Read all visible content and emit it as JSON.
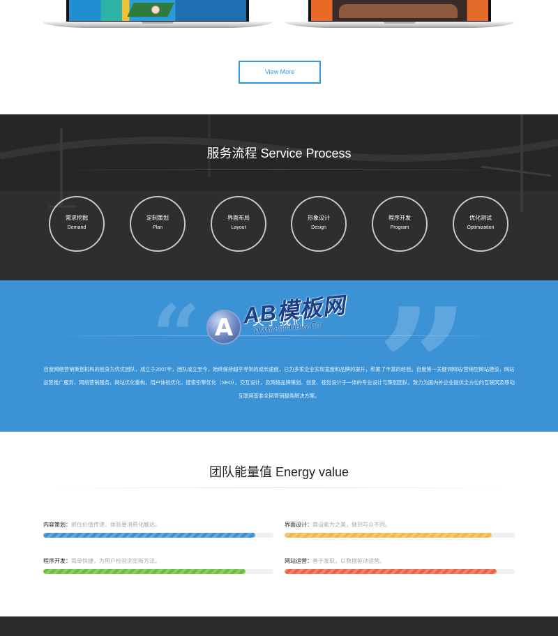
{
  "view_more": {
    "label": "View More"
  },
  "service": {
    "title": "服务流程 Service Process",
    "steps": [
      {
        "zh": "需求挖掘",
        "en": "Demand"
      },
      {
        "zh": "定制策划",
        "en": "Plan"
      },
      {
        "zh": "界面布局",
        "en": "Layout"
      },
      {
        "zh": "形象设计",
        "en": "Design"
      },
      {
        "zh": "程序开发",
        "en": "Program"
      },
      {
        "zh": "优化测试",
        "en": "Optimization"
      }
    ]
  },
  "about": {
    "title": "关于我们",
    "watermark": {
      "badge": "A",
      "brand": "AB模板网",
      "url": "Www.AdminBuy.Cn"
    },
    "description": "自度网络营销策划机构的前身为优优团队，成立于2007年，团队成立至今，始终保持超乎寻常的成长速度，已为多家企业实现宽度和品牌的提升，积累了丰富的经验。自度第一关键词网站/营销型网站建设，网站运营推广服务，网络营销服务，网站优化重构，用户体验优化，搜索引擎优化（SEO），交互设计，及网络品牌策划、创意、视觉设计于一体的专业设计与策划团队，致力为国内外企业提供全方位的互联网及移动互联网基准全网营销服务解决方案。"
  },
  "energy": {
    "title": "团队能量值 Energy value",
    "skills": [
      {
        "name": "内容策划：",
        "note": "抓住价值传递，体验要消费化触达。",
        "percent": 92,
        "color": "#3b8fd3"
      },
      {
        "name": "界面设计：",
        "note": "简设能为之美，做到与众不同。",
        "percent": 90,
        "color": "#f0b84a"
      },
      {
        "name": "程序开发：",
        "note": "简单快捷，为用户检验浏览新方法。",
        "percent": 88,
        "color": "#6bbf3b"
      },
      {
        "name": "网站运营：",
        "note": "善于发现，以数据驱动运营。",
        "percent": 92,
        "color": "#ef6146"
      }
    ]
  },
  "colors": {
    "accent": "#3498db",
    "service_bg": "#2a2a2a",
    "about_bg": "#3b93d6",
    "footer_bg": "#2b2b2b"
  }
}
